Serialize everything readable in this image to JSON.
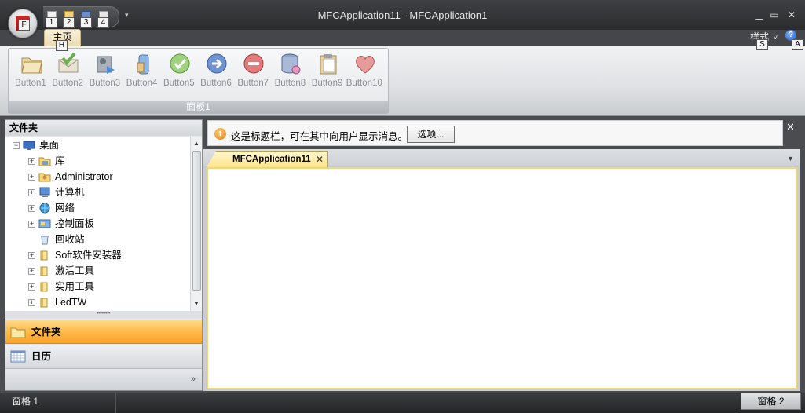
{
  "window": {
    "title_doc": "MFCApplication11",
    "title_sep": " - ",
    "title_app": "MFCApplication1",
    "minimize_glyph": "▁",
    "maximize_glyph": "▭",
    "close_glyph": "✕"
  },
  "app_button": {
    "key_tip": "F"
  },
  "quick_access": {
    "items": [
      {
        "key_tip": "1"
      },
      {
        "key_tip": "2"
      },
      {
        "key_tip": "3"
      },
      {
        "key_tip": "4"
      }
    ],
    "dropdown_glyph": "▾"
  },
  "ribbon": {
    "tabs": [
      {
        "label": "主页",
        "key_tip": "H"
      }
    ],
    "style_menu": {
      "label": "样式",
      "glyph": "˅",
      "key_tip": "S"
    },
    "help": {
      "glyph": "?",
      "key_tip": "A"
    },
    "panel": {
      "caption": "面板1",
      "buttons": [
        {
          "label": "Button1",
          "icon": "folder-open-icon"
        },
        {
          "label": "Button2",
          "icon": "mail-check-icon"
        },
        {
          "label": "Button3",
          "icon": "media-player-icon"
        },
        {
          "label": "Button4",
          "icon": "bottle-icon"
        },
        {
          "label": "Button5",
          "icon": "check-circle-icon"
        },
        {
          "label": "Button6",
          "icon": "arrow-right-circle-icon"
        },
        {
          "label": "Button7",
          "icon": "minus-circle-icon"
        },
        {
          "label": "Button8",
          "icon": "database-icon"
        },
        {
          "label": "Button9",
          "icon": "clipboard-icon"
        },
        {
          "label": "Button10",
          "icon": "heart-icon"
        }
      ]
    }
  },
  "left_pane": {
    "caption": "文件夹",
    "tree": [
      {
        "label": "桌面",
        "level": 0,
        "expander": "−",
        "icon": "desktop-icon"
      },
      {
        "label": "库",
        "level": 1,
        "expander": "+",
        "icon": "library-folder-icon"
      },
      {
        "label": "Administrator",
        "level": 1,
        "expander": "+",
        "icon": "user-folder-icon"
      },
      {
        "label": "计算机",
        "level": 1,
        "expander": "+",
        "icon": "computer-icon"
      },
      {
        "label": "网络",
        "level": 1,
        "expander": "+",
        "icon": "network-icon"
      },
      {
        "label": "控制面板",
        "level": 1,
        "expander": "+",
        "icon": "control-panel-icon"
      },
      {
        "label": "回收站",
        "level": 1,
        "expander": "",
        "icon": "recycle-bin-icon"
      },
      {
        "label": "Soft软件安装器",
        "level": 1,
        "expander": "+",
        "icon": "folder-icon"
      },
      {
        "label": "激活工具",
        "level": 1,
        "expander": "+",
        "icon": "folder-icon"
      },
      {
        "label": "实用工具",
        "level": 1,
        "expander": "+",
        "icon": "folder-icon"
      },
      {
        "label": "LedTW",
        "level": 1,
        "expander": "+",
        "icon": "folder-icon"
      }
    ],
    "scroll_up": "▲",
    "scroll_down": "▼",
    "splitter_glyph": "••••••••",
    "nav_buttons": [
      {
        "label": "文件夹",
        "icon": "folder-icon",
        "active": true
      },
      {
        "label": "日历",
        "icon": "calendar-icon",
        "active": false
      }
    ],
    "more_glyph": "»"
  },
  "message_bar": {
    "text": "这是标题栏，可在其中向用户显示消息。",
    "button": "选项...",
    "close_glyph": "✕",
    "icon_glyph": "i"
  },
  "document": {
    "tab_label": "MFCApplication11",
    "tab_close_glyph": "✕",
    "menu_glyph": "▼"
  },
  "status_bar": {
    "left": "窗格 1",
    "right": "窗格 2"
  }
}
